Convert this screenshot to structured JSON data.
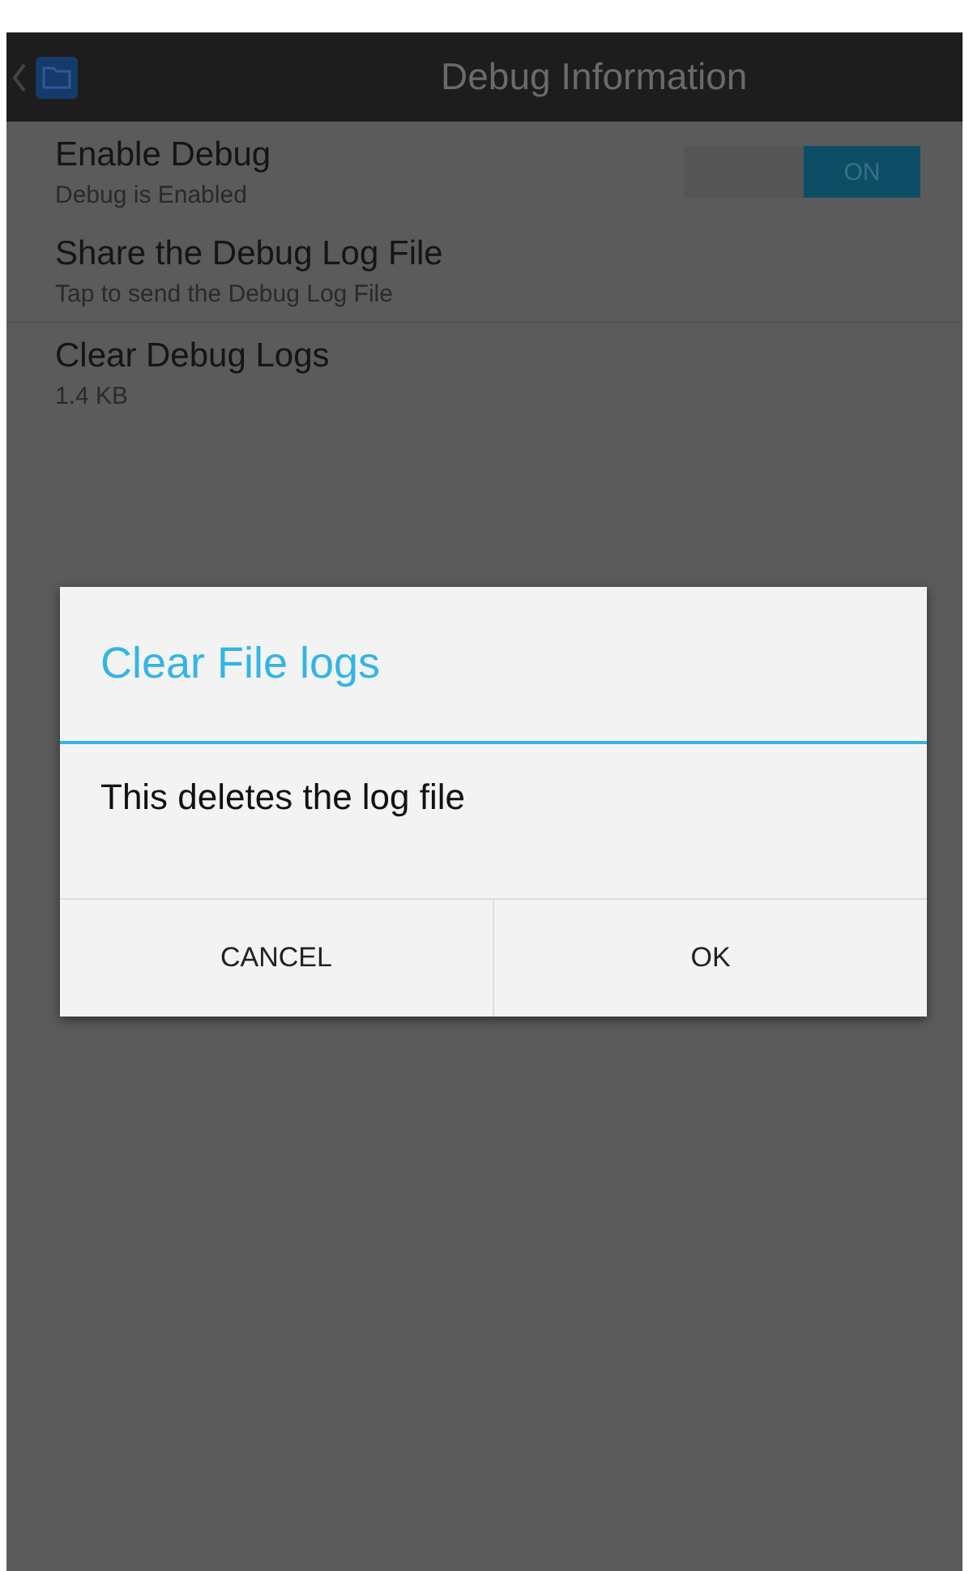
{
  "header": {
    "title": "Debug Information"
  },
  "settings": [
    {
      "kind": "toggle",
      "title": "Enable Debug",
      "subtitle": "Debug is Enabled",
      "on": true,
      "toggle_label": "ON"
    },
    {
      "kind": "plain",
      "title": "Share the Debug Log File",
      "subtitle": "Tap to send the Debug Log File"
    },
    {
      "kind": "plain",
      "title": "Clear Debug Logs",
      "subtitle": "1.4 KB"
    }
  ],
  "dialog": {
    "title": "Clear File logs",
    "message": "This deletes the log file",
    "buttons": [
      "CANCEL",
      "OK"
    ]
  }
}
